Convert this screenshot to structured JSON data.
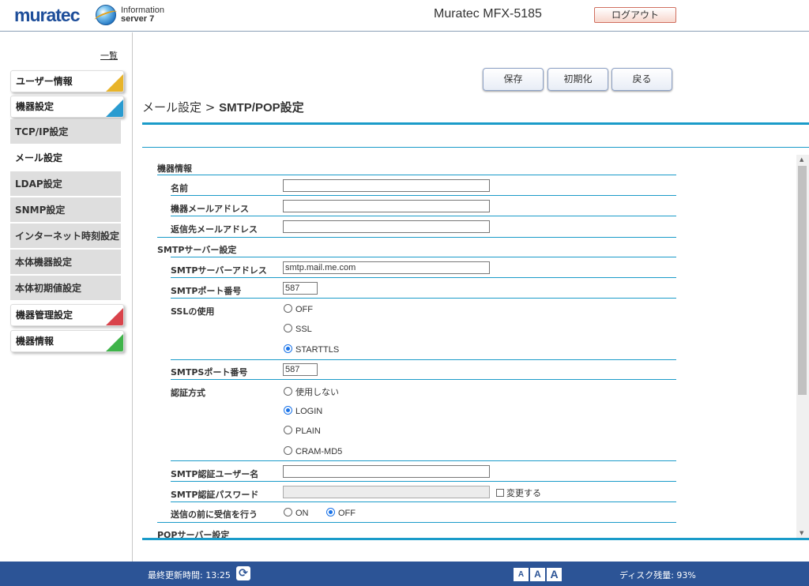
{
  "header": {
    "logo": "muratec",
    "product_line1": "Information",
    "product_line2": "server 7",
    "model": "Muratec MFX-5185",
    "logout_label": "ログアウト"
  },
  "sidebar": {
    "list_link": "一覧",
    "categories": [
      {
        "label": "ユーザー情報",
        "color": "#e8b42a"
      },
      {
        "label": "機器設定",
        "color": "#2a9bd0"
      },
      {
        "label": "機器管理設定",
        "color": "#d9434b"
      },
      {
        "label": "機器情報",
        "color": "#3fb44a"
      }
    ],
    "sub_items": [
      "TCP/IP設定",
      "メール設定",
      "LDAP設定",
      "SNMP設定",
      "インターネット時刻設定",
      "本体機器設定",
      "本体初期値設定"
    ],
    "active_sub": "メール設定"
  },
  "toolbar": {
    "save_label": "保存",
    "init_label": "初期化",
    "back_label": "戻る"
  },
  "page": {
    "title_prefix": "メール設定 > ",
    "title_main": "SMTP/POP設定"
  },
  "form": {
    "device_info": {
      "section": "機器情報",
      "name_label": "名前",
      "name_value": "",
      "mail_label": "機器メールアドレス",
      "mail_value": "",
      "reply_label": "返信先メールアドレス",
      "reply_value": ""
    },
    "smtp": {
      "section": "SMTPサーバー設定",
      "address_label": "SMTPサーバーアドレス",
      "address_value": "smtp.mail.me.com",
      "port_label": "SMTPポート番号",
      "port_value": "587",
      "ssl_label": "SSLの使用",
      "ssl_options": [
        "OFF",
        "SSL",
        "STARTTLS"
      ],
      "ssl_selected": "STARTTLS",
      "smtps_port_label": "SMTPSポート番号",
      "smtps_port_value": "587",
      "auth_label": "認証方式",
      "auth_options": [
        "使用しない",
        "LOGIN",
        "PLAIN",
        "CRAM-MD5"
      ],
      "auth_selected": "LOGIN",
      "user_label": "SMTP認証ユーザー名",
      "user_value": "",
      "password_label": "SMTP認証パスワード",
      "password_value": "",
      "change_label": "変更する",
      "pop_before_label": "送信の前に受信を行う",
      "pop_before_options": [
        "ON",
        "OFF"
      ],
      "pop_before_selected": "OFF"
    },
    "pop": {
      "section": "POPサーバー設定"
    }
  },
  "footer": {
    "update_label": "最終更新時間: 13:25",
    "font_sizes": [
      "A",
      "A",
      "A"
    ],
    "disk_label": "ディスク残量: 93%"
  }
}
